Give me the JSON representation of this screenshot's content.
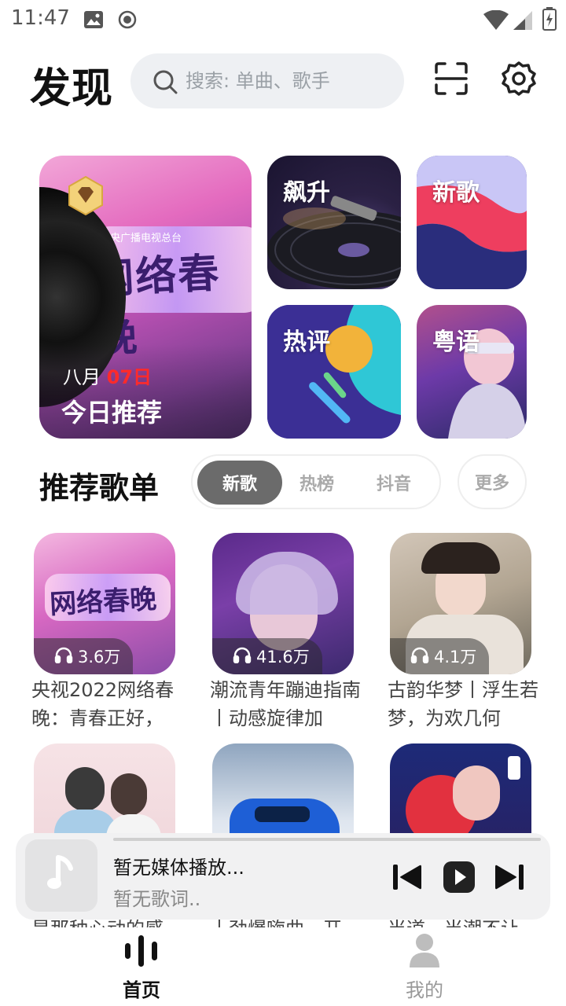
{
  "status_bar": {
    "time": "11:47"
  },
  "header": {
    "title": "发现",
    "search_placeholder": "搜索: 单曲、歌手"
  },
  "featured": {
    "banner": {
      "month": "八月",
      "day": "07日",
      "label": "今日推荐",
      "art_subtext": "央广播电视总台",
      "art_text": "网络春晚"
    },
    "tiles": [
      {
        "label": "飙升"
      },
      {
        "label": "新歌"
      },
      {
        "label": "热评"
      },
      {
        "label": "粤语"
      }
    ]
  },
  "playlists_section": {
    "title": "推荐歌单",
    "tabs": [
      {
        "label": "新歌",
        "active": true
      },
      {
        "label": "热榜",
        "active": false
      },
      {
        "label": "抖音",
        "active": false
      }
    ],
    "more_label": "更多",
    "items": [
      {
        "play_count": "3.6万",
        "title": "央视2022网络春晚：青春正好，"
      },
      {
        "play_count": "41.6万",
        "title": "潮流青年蹦迪指南丨动感旋律加"
      },
      {
        "play_count": "4.1万",
        "title": "古韵华梦丨浮生若梦，为欢几何"
      },
      {
        "play_count": "",
        "title": "是那种心动的感"
      },
      {
        "play_count": "",
        "title": "丨劲爆嗨曲，开"
      },
      {
        "play_count": "",
        "title": "当道，当潮不让"
      }
    ]
  },
  "player": {
    "title": "暂无媒体播放...",
    "lyric": "暂无歌词.."
  },
  "bottom_nav": [
    {
      "label": "首页",
      "active": true
    },
    {
      "label": "我的",
      "active": false
    }
  ]
}
